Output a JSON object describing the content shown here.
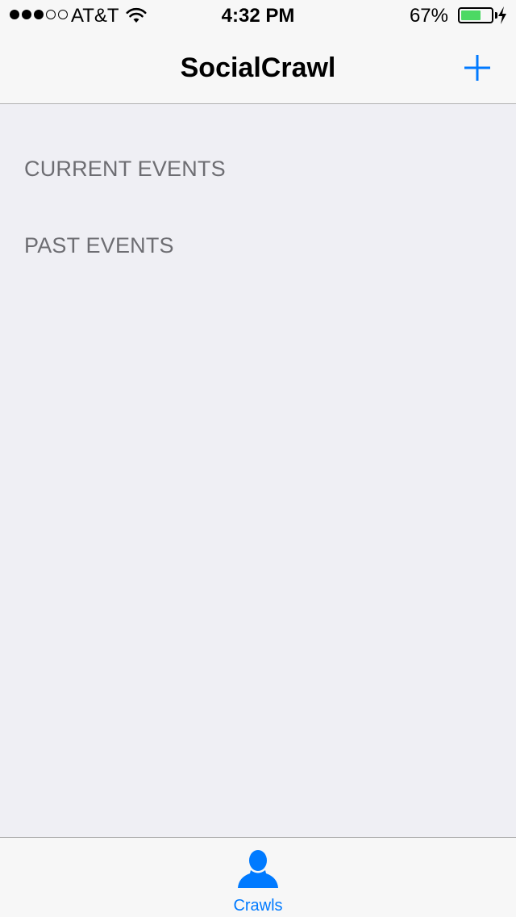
{
  "status_bar": {
    "signal_dots_filled": 3,
    "signal_dots_total": 5,
    "carrier": "AT&T",
    "wifi_icon": "wifi-icon",
    "time": "4:32 PM",
    "battery_percent": "67%",
    "battery_level": 0.67,
    "charging_icon": "charging-bolt-icon"
  },
  "nav": {
    "title": "SocialCrawl",
    "add_icon": "plus-icon"
  },
  "sections": [
    {
      "label": "CURRENT EVENTS"
    },
    {
      "label": "PAST EVENTS"
    }
  ],
  "tab_bar": {
    "tabs": [
      {
        "label": "Crawls",
        "icon": "person-icon",
        "selected": true
      }
    ]
  },
  "colors": {
    "accent": "#007aff",
    "background": "#efeff4",
    "bar_background": "#f7f7f7",
    "section_text": "#6d6d72",
    "battery_fill": "#4cd964"
  }
}
